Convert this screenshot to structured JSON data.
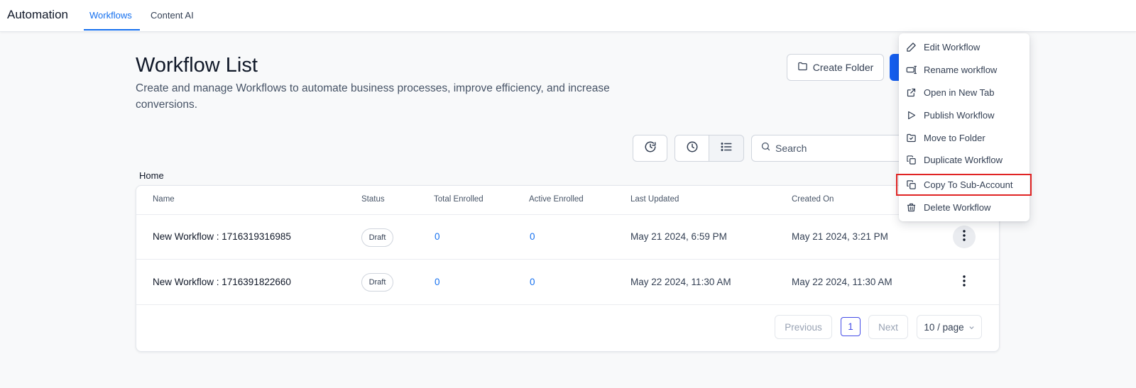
{
  "topbar": {
    "app_title": "Automation",
    "tabs": [
      {
        "label": "Workflows",
        "active": true
      },
      {
        "label": "Content AI",
        "active": false
      }
    ]
  },
  "header": {
    "title": "Workflow List",
    "description": "Create and manage Workflows to automate business processes, improve efficiency, and increase conversions.",
    "create_folder_label": "Create Folder"
  },
  "toolbar": {
    "search_placeholder": "Search"
  },
  "breadcrumb": "Home",
  "table": {
    "columns": [
      "Name",
      "Status",
      "Total Enrolled",
      "Active Enrolled",
      "Last Updated",
      "Created On"
    ],
    "rows": [
      {
        "name": "New Workflow : 1716319316985",
        "status": "Draft",
        "total_enrolled": "0",
        "active_enrolled": "0",
        "last_updated": "May 21 2024, 6:59 PM",
        "created_on": "May 21 2024, 3:21 PM"
      },
      {
        "name": "New Workflow : 1716391822660",
        "status": "Draft",
        "total_enrolled": "0",
        "active_enrolled": "0",
        "last_updated": "May 22 2024, 11:30 AM",
        "created_on": "May 22 2024, 11:30 AM"
      }
    ]
  },
  "pagination": {
    "previous_label": "Previous",
    "current_page": "1",
    "next_label": "Next",
    "page_size": "10 / page"
  },
  "context_menu": {
    "items": [
      {
        "label": "Edit Workflow",
        "icon": "pencil-icon"
      },
      {
        "label": "Rename workflow",
        "icon": "rename-icon"
      },
      {
        "label": "Open in New Tab",
        "icon": "external-link-icon"
      },
      {
        "label": "Publish Workflow",
        "icon": "play-icon"
      },
      {
        "label": "Move to Folder",
        "icon": "folder-move-icon"
      },
      {
        "label": "Duplicate Workflow",
        "icon": "duplicate-icon"
      },
      {
        "label": "Copy To Sub-Account",
        "icon": "copy-icon",
        "highlighted": true
      },
      {
        "label": "Delete Workflow",
        "icon": "trash-icon"
      }
    ]
  },
  "colors": {
    "accent": "#155eef",
    "tab_active": "#1570ef",
    "highlight_border": "#e02424"
  }
}
